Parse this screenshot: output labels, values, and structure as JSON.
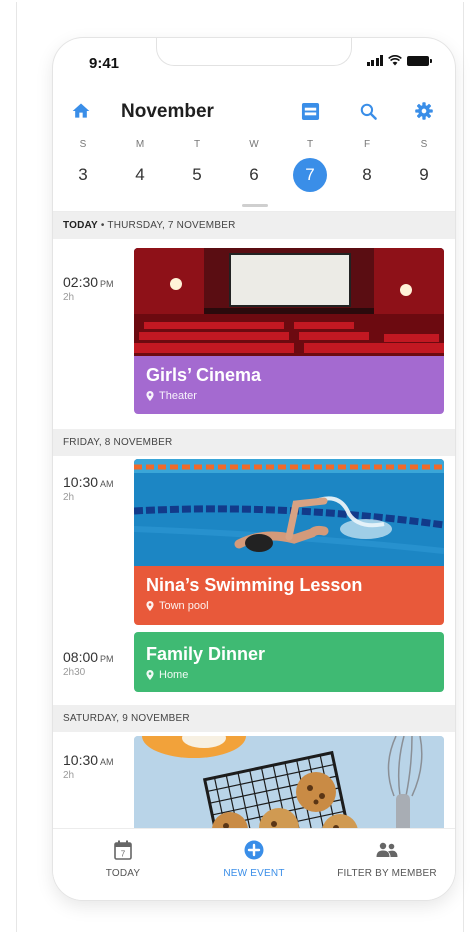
{
  "status_bar": {
    "time": "9:41"
  },
  "header": {
    "month": "November",
    "icons": [
      "home-icon",
      "calendar-view-icon",
      "search-icon",
      "gear-icon"
    ],
    "accent_color": "#3a8ee8"
  },
  "week": [
    {
      "name": "S",
      "date": "3",
      "selected": false
    },
    {
      "name": "M",
      "date": "4",
      "selected": false
    },
    {
      "name": "T",
      "date": "5",
      "selected": false
    },
    {
      "name": "W",
      "date": "6",
      "selected": false
    },
    {
      "name": "T",
      "date": "7",
      "selected": true
    },
    {
      "name": "F",
      "date": "8",
      "selected": false
    },
    {
      "name": "S",
      "date": "9",
      "selected": false
    }
  ],
  "sections": [
    {
      "prefix": "TODAY",
      "separator": " • ",
      "label": "THURSDAY, 7 NOVEMBER",
      "events": [
        {
          "time": "02:30",
          "ampm": "PM",
          "duration": "2h",
          "title": "Girls’ Cinema",
          "location": "Theater",
          "color": "#a46ad0",
          "image": "cinema"
        }
      ]
    },
    {
      "prefix": "",
      "separator": "",
      "label": "FRIDAY, 8 NOVEMBER",
      "events": [
        {
          "time": "10:30",
          "ampm": "AM",
          "duration": "2h",
          "title": "Nina’s Swimming Lesson",
          "location": "Town pool",
          "color": "#e8593a",
          "image": "pool"
        },
        {
          "time": "08:00",
          "ampm": "PM",
          "duration": "2h30",
          "title": "Family Dinner",
          "location": "Home",
          "color": "#3fba73",
          "image": ""
        }
      ]
    },
    {
      "prefix": "",
      "separator": "",
      "label": "SATURDAY, 9 NOVEMBER",
      "events": [
        {
          "time": "10:30",
          "ampm": "AM",
          "duration": "2h",
          "title": "",
          "location": "",
          "color": "#a9c8e0",
          "image": "cookies"
        }
      ]
    }
  ],
  "bottom_nav": {
    "today": {
      "label": "TODAY",
      "icon": "calendar-today-icon",
      "day": "7"
    },
    "new_event": {
      "label": "NEW EVENT",
      "icon": "add-circle-icon"
    },
    "filter": {
      "label": "FILTER BY MEMBER",
      "icon": "people-icon"
    }
  }
}
